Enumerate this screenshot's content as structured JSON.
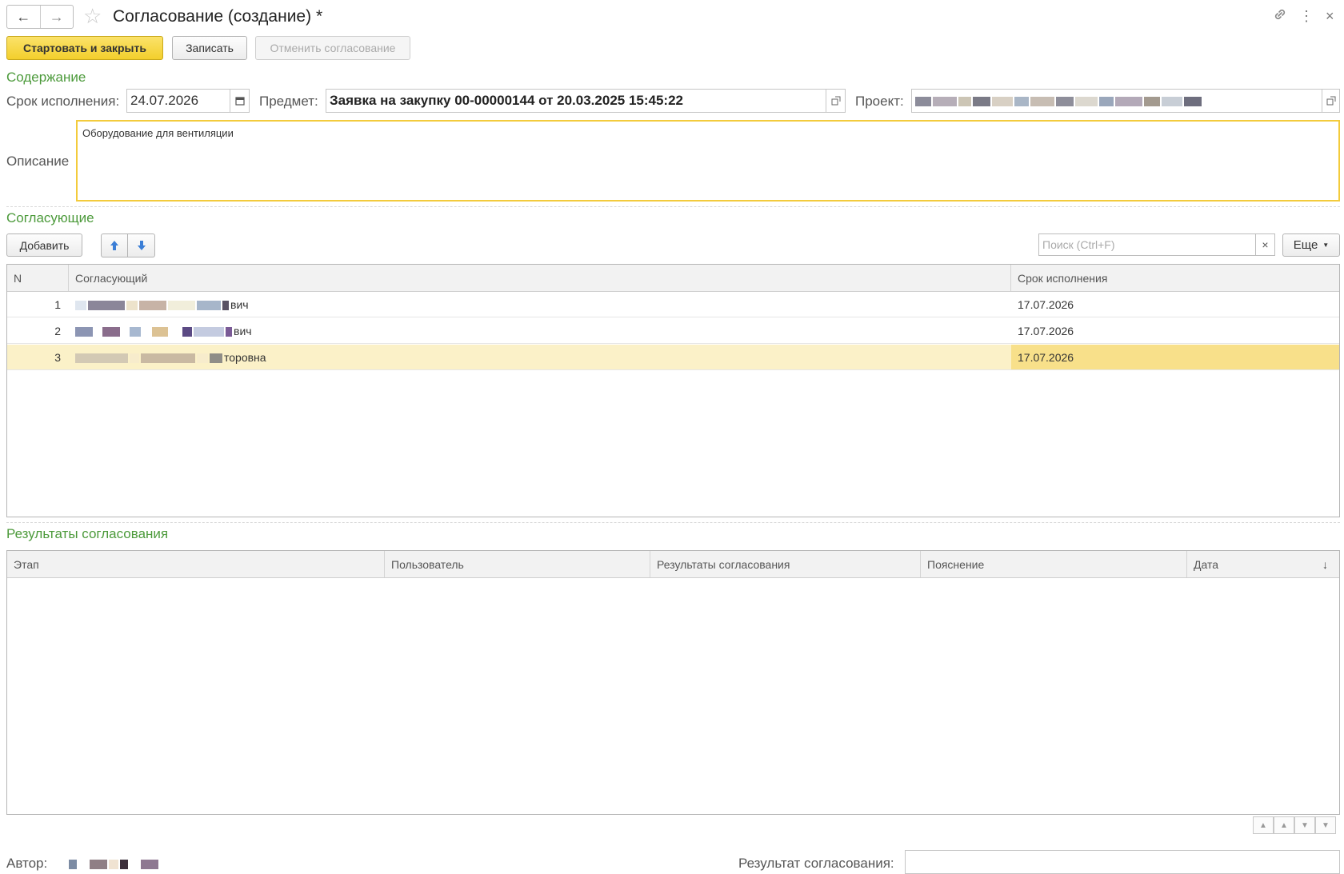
{
  "window": {
    "title": "Согласование (создание) *",
    "icons": [
      "back-arrow-icon",
      "forward-arrow-icon",
      "star-icon",
      "link-icon",
      "more-icon",
      "close-icon"
    ]
  },
  "toolbar": {
    "start_close": "Стартовать и закрыть",
    "save": "Записать",
    "cancel_approval": "Отменить согласование"
  },
  "content": {
    "section_title": "Содержание",
    "due_label": "Срок исполнения:",
    "due_value": "24.07.2026",
    "subject_label": "Предмет:",
    "subject_value": "Заявка на закупку 00-00000144 от 20.03.2025 15:45:22",
    "project_label": "Проект:",
    "description_label": "Описание",
    "description_value": "Оборудование для вентиляции"
  },
  "approvers": {
    "section_title": "Согласующие",
    "add": "Добавить",
    "search_placeholder": "Поиск (Ctrl+F)",
    "search_clear": "×",
    "more": "Еще",
    "columns": [
      "N",
      "Согласующий",
      "Срок исполнения"
    ],
    "rows": [
      {
        "n": "1",
        "name_suffix": "вич",
        "due": "17.07.2026"
      },
      {
        "n": "2",
        "name_suffix": "вич",
        "due": "17.07.2026"
      },
      {
        "n": "3",
        "name_suffix": "торовна",
        "due": "17.07.2026"
      }
    ],
    "selected_row": 3
  },
  "results": {
    "section_title": "Результаты согласования",
    "columns": [
      "Этап",
      "Пользователь",
      "Результаты согласования",
      "Пояснение",
      "Дата"
    ],
    "sort_icon": "sort-down-arrow-icon"
  },
  "footer": {
    "author_label": "Автор:",
    "result_label": "Результат согласования:",
    "result_value": ""
  },
  "colors": {
    "accent_yellow": "#f3cf2c",
    "section_green": "#4c9a3b",
    "selected_row": "#fbf1c8",
    "selected_cell": "#f8e08a"
  }
}
